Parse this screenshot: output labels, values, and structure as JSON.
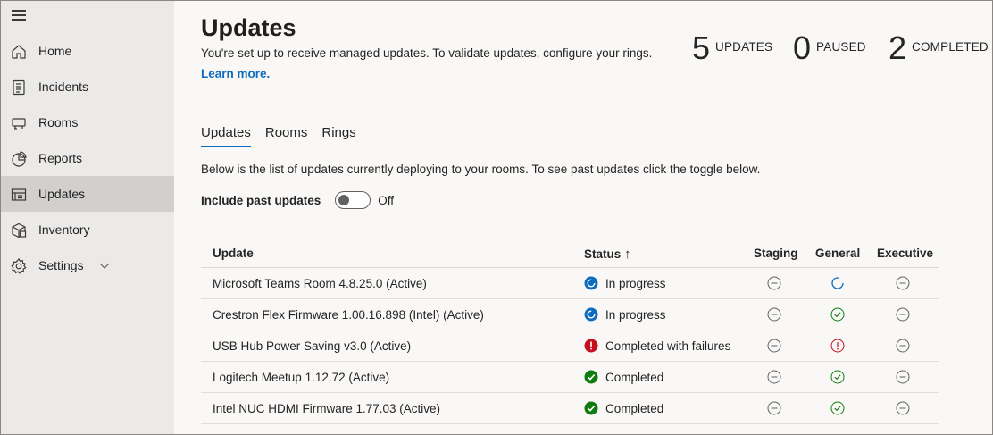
{
  "sidebar": {
    "items": [
      {
        "label": "Home",
        "icon": "home-icon"
      },
      {
        "label": "Incidents",
        "icon": "incidents-icon"
      },
      {
        "label": "Rooms",
        "icon": "rooms-icon"
      },
      {
        "label": "Reports",
        "icon": "reports-icon"
      },
      {
        "label": "Updates",
        "icon": "updates-icon",
        "active": true
      },
      {
        "label": "Inventory",
        "icon": "inventory-icon"
      },
      {
        "label": "Settings",
        "icon": "settings-icon",
        "expandable": true
      }
    ]
  },
  "header": {
    "title": "Updates",
    "subtitle": "You're set up to receive managed updates. To validate updates, configure your rings.",
    "learn_more": "Learn more."
  },
  "stats": [
    {
      "value": "5",
      "label": "UPDATES"
    },
    {
      "value": "0",
      "label": "PAUSED"
    },
    {
      "value": "2",
      "label": "COMPLETED"
    }
  ],
  "tabs": [
    {
      "label": "Updates",
      "active": true
    },
    {
      "label": "Rooms"
    },
    {
      "label": "Rings"
    }
  ],
  "description": "Below is the list of updates currently deploying to your rooms. To see past updates click the toggle below.",
  "toggle": {
    "label": "Include past updates",
    "state": "Off"
  },
  "table": {
    "columns": [
      "Update",
      "Status",
      "Staging",
      "General",
      "Executive"
    ],
    "sort_indicator": "↑",
    "rows": [
      {
        "update": "Microsoft Teams Room 4.8.25.0 (Active)",
        "status": "In progress",
        "status_icon": "in-progress",
        "staging": "not-started",
        "general": "in-progress",
        "executive": "not-started"
      },
      {
        "update": "Crestron Flex Firmware 1.00.16.898 (Intel) (Active)",
        "status": "In progress",
        "status_icon": "in-progress",
        "staging": "not-started",
        "general": "completed",
        "executive": "not-started"
      },
      {
        "update": "USB Hub Power Saving v3.0 (Active)",
        "status": "Completed with failures",
        "status_icon": "failure",
        "staging": "not-started",
        "general": "failure",
        "executive": "not-started"
      },
      {
        "update": "Logitech Meetup 1.12.72 (Active)",
        "status": "Completed",
        "status_icon": "completed",
        "staging": "not-started",
        "general": "completed",
        "executive": "not-started"
      },
      {
        "update": "Intel NUC HDMI Firmware 1.77.03 (Active)",
        "status": "Completed",
        "status_icon": "completed",
        "staging": "not-started",
        "general": "completed",
        "executive": "not-started"
      }
    ]
  },
  "colors": {
    "accent": "#0f6cbd",
    "success": "#107c10",
    "error": "#c50f1f",
    "progress": "#0f6cbd",
    "sidebar_bg": "#ebeae9",
    "sidebar_active": "#d2d0ce"
  }
}
